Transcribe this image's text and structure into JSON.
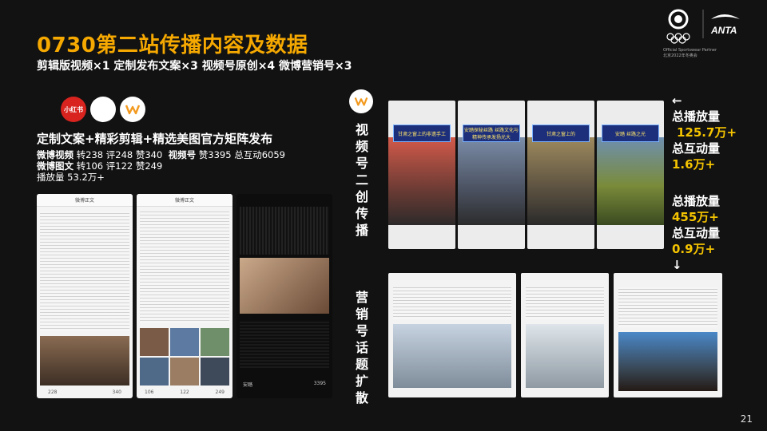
{
  "header": {
    "title": "0730第二站传播内容及数据",
    "subtitle": "剪辑版视频×1   定制发布文案×3   视频号原创×4   微博营销号×3"
  },
  "logos": {
    "brand": "ANTA",
    "sub_line1": "Official Sportswear Partner",
    "sub_line2": "北京2022年冬奥会",
    "platform_xiaohongshu": "小红书"
  },
  "left_panel": {
    "heading": "定制文案+精彩剪辑+精选美图官方矩阵发布",
    "stats_line1_label": "微博视频",
    "stats_line1_values": "转238 评248 赞340",
    "stats_line1b_label": "视频号",
    "stats_line1b_values": "赞3395 总互动6059",
    "stats_line2_label": "微博图文",
    "stats_line2_values": "转106 评122 赞249",
    "stats_line3": "播放量 53.2万+"
  },
  "phones": [
    {
      "bar": "微博正文",
      "bottom_left": "228",
      "bottom_right": "340"
    },
    {
      "bar": "微博正文",
      "bottom_left": "106",
      "bottom_mid": "122",
      "bottom_right": "249"
    },
    {
      "bottom_left": "安踏",
      "bottom_right": "3395"
    }
  ],
  "sections": {
    "video_label": "视频号二创传播",
    "marketing_label": "营销号话题扩散"
  },
  "right_stats": {
    "arrow_up": "←",
    "play_label_1": "总播放量",
    "play_value_1": "125.7万+",
    "interact_label_1": "总互动量",
    "interact_value_1": "1.6万+",
    "play_label_2": "总播放量",
    "play_value_2": "455万+",
    "interact_label_2": "总互动量",
    "interact_value_2": "0.9万+",
    "arrow_down": "↓"
  },
  "video_thumbs": [
    {
      "banner": "甘肃之窗上的非遗手工"
    },
    {
      "banner": "安踏探秘丝路 丝路文化与精神传承发扬光大"
    },
    {
      "banner": "甘肃之窗上的"
    },
    {
      "banner": "安踏 丝路之光"
    }
  ],
  "page_number": "21",
  "colors": {
    "accent": "#f5a800",
    "background": "#121212",
    "stat_gold": "#f5c400"
  }
}
